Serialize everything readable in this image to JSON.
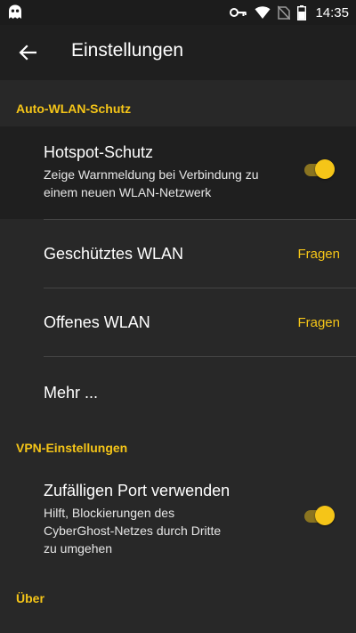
{
  "statusbar": {
    "time": "14:35",
    "icons": [
      "ghost-icon",
      "key-icon",
      "wifi-icon",
      "no-sim-icon",
      "battery-icon"
    ]
  },
  "appbar": {
    "back_icon": "arrow-left-icon",
    "title": "Einstellungen"
  },
  "sections": {
    "auto_wlan": {
      "header": "Auto-WLAN-Schutz"
    },
    "vpn": {
      "header": "VPN-Einstellungen"
    },
    "about": {
      "header": "Über"
    }
  },
  "items": {
    "hotspot": {
      "title": "Hotspot-Schutz",
      "subtitle_line1": "Zeige Warnmeldung bei Verbindung zu",
      "subtitle_line2": "einem neuen WLAN-Netzwerk",
      "toggle_on": true
    },
    "protected_wlan": {
      "title": "Geschütztes WLAN",
      "value": "Fragen"
    },
    "open_wlan": {
      "title": "Offenes WLAN",
      "value": "Fragen"
    },
    "more": {
      "title": "Mehr ..."
    },
    "random_port": {
      "title": "Zufälligen Port verwenden",
      "subtitle_line1": "Hilft, Blockierungen des",
      "subtitle_line2": "CyberGhost-Netzes durch Dritte",
      "subtitle_line3": "zu umgehen",
      "toggle_on": true
    }
  },
  "colors": {
    "accent": "#f5c518",
    "background": "#282828",
    "surface": "#1f1f1f"
  }
}
